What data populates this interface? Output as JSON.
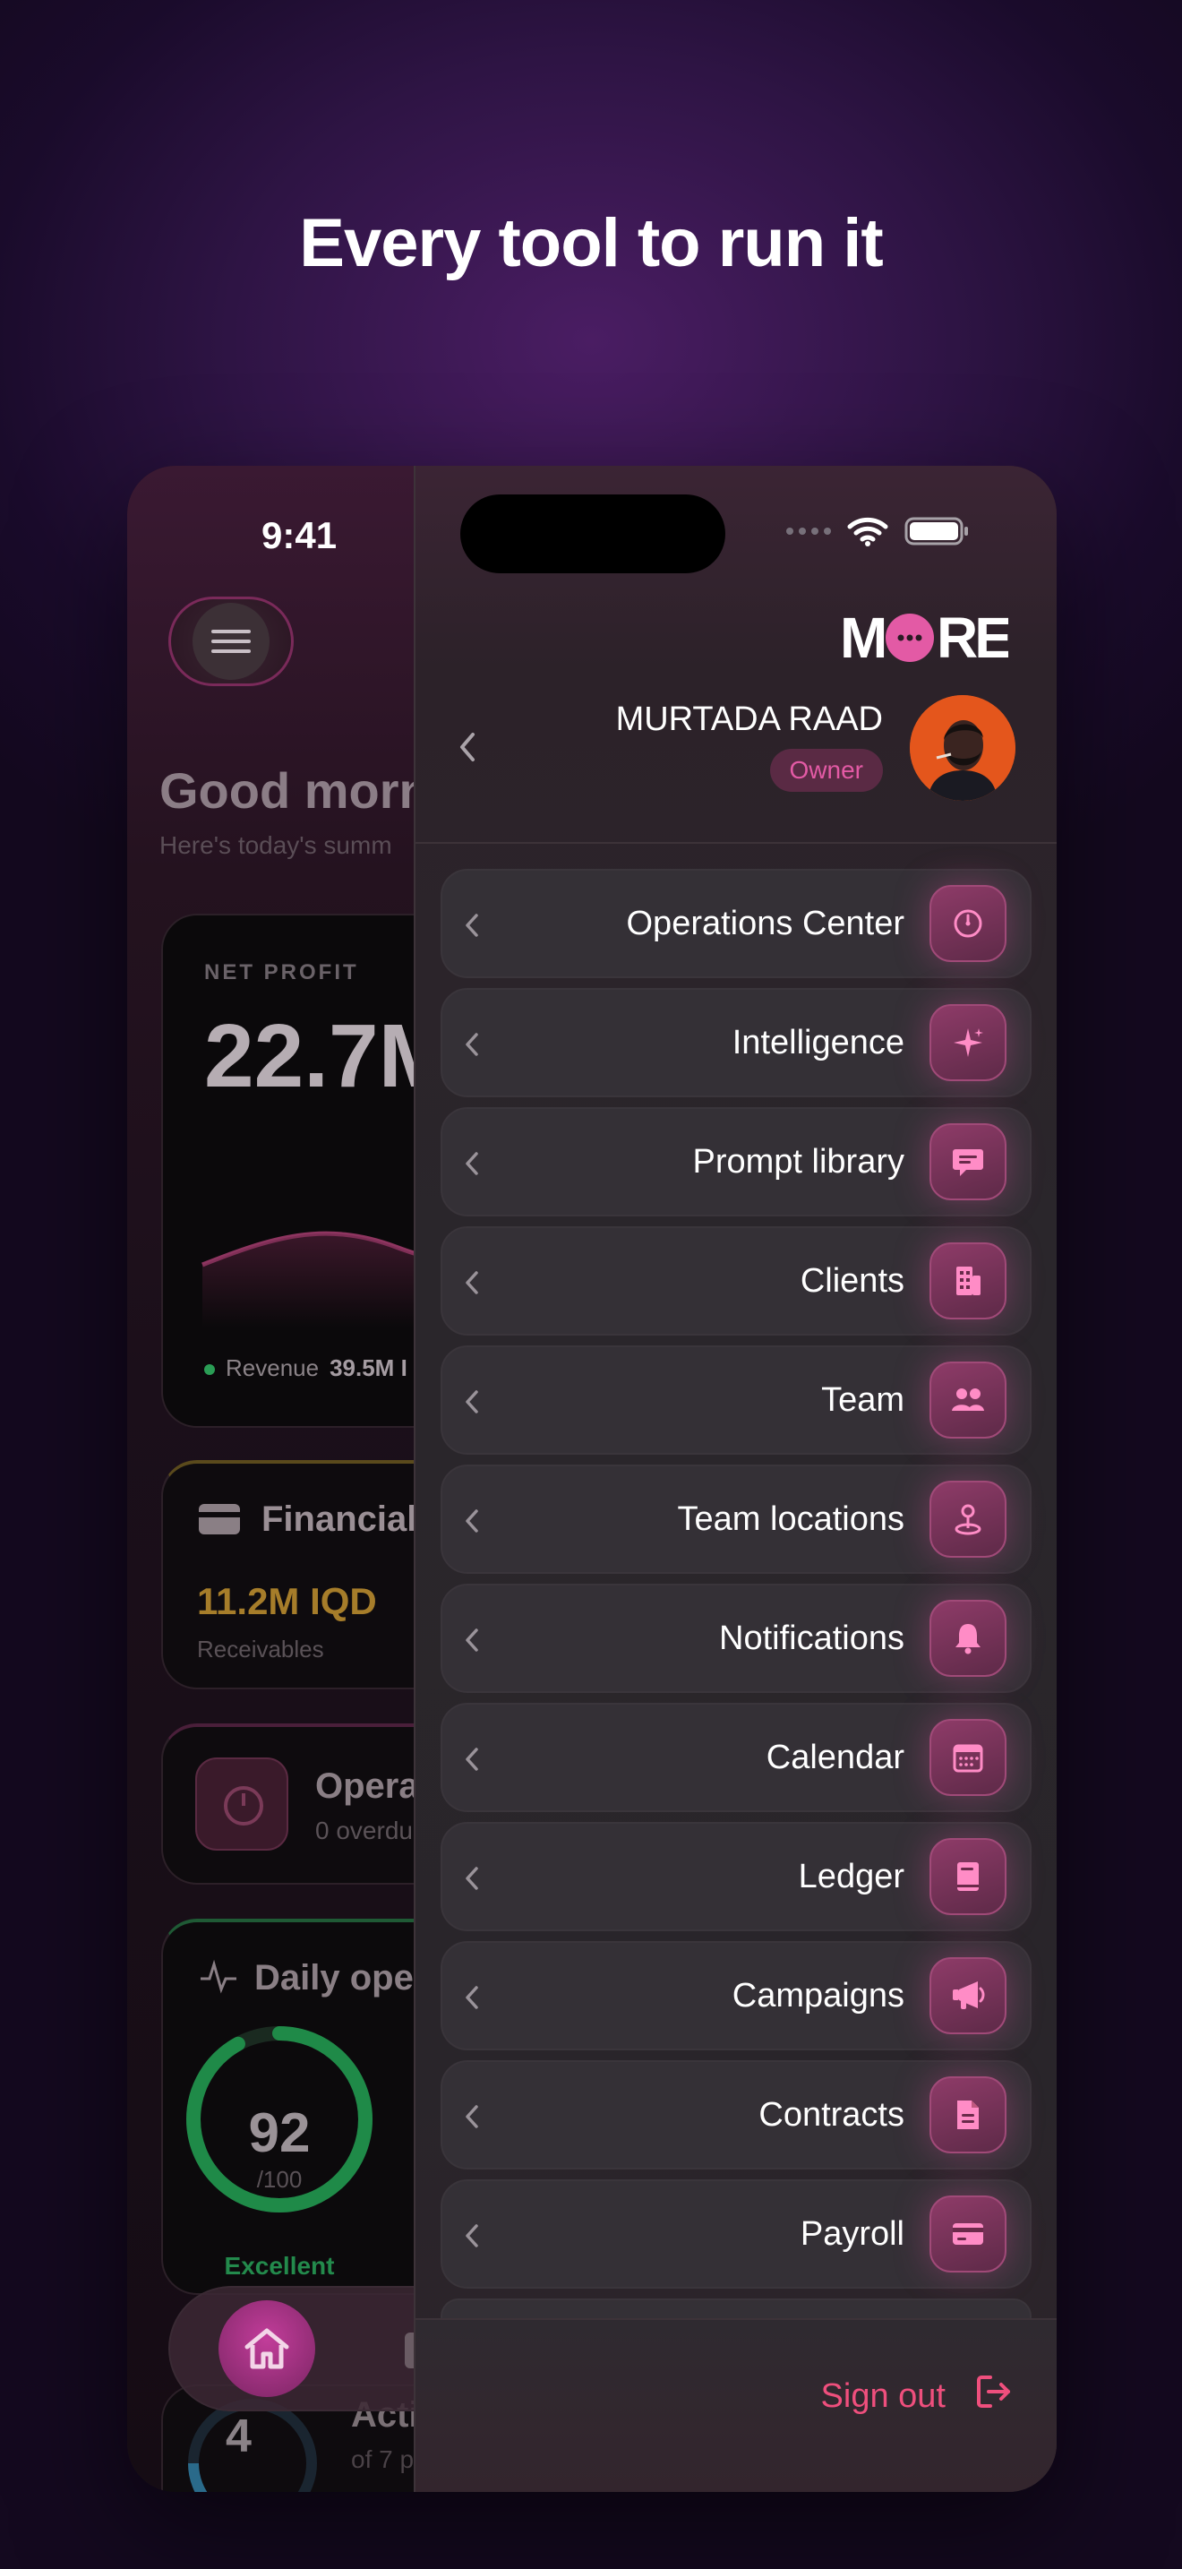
{
  "headline": "Every tool to run it",
  "status_bar": {
    "time": "9:41"
  },
  "dashboard": {
    "greeting": "Good morn",
    "greeting_sub": "Here's today's summ",
    "net_profit": {
      "label": "NET PROFIT",
      "value": "22.7M",
      "legend_label": "Revenue",
      "legend_value": "39.5M I"
    },
    "financial": {
      "title": "Financial",
      "value": "11.2M IQD",
      "sub": "Receivables"
    },
    "operations": {
      "title": "Opera",
      "sub": "0 overdu"
    },
    "daily": {
      "title": "Daily oper",
      "score": "92",
      "max": "/100",
      "rating": "Excellent",
      "score_fraction": 0.92
    },
    "activity": {
      "number": "4",
      "title": "Activ",
      "sub": "of 7 pr"
    }
  },
  "drawer": {
    "brand": "MORE",
    "profile": {
      "name": "MURTADA RAAD",
      "role": "Owner"
    },
    "items": [
      {
        "label": "Operations Center",
        "icon": "gauge-icon"
      },
      {
        "label": "Intelligence",
        "icon": "sparkle-icon"
      },
      {
        "label": "Prompt library",
        "icon": "chat-bubble-icon"
      },
      {
        "label": "Clients",
        "icon": "building-icon"
      },
      {
        "label": "Team",
        "icon": "people-icon"
      },
      {
        "label": "Team locations",
        "icon": "location-pin-icon"
      },
      {
        "label": "Notifications",
        "icon": "bell-icon"
      },
      {
        "label": "Calendar",
        "icon": "calendar-icon"
      },
      {
        "label": "Ledger",
        "icon": "book-icon"
      },
      {
        "label": "Campaigns",
        "icon": "megaphone-icon"
      },
      {
        "label": "Contracts",
        "icon": "document-icon"
      },
      {
        "label": "Payroll",
        "icon": "credit-card-icon"
      }
    ],
    "sign_out": "Sign out"
  },
  "colors": {
    "accent": "#e35aa5",
    "danger": "#ef4f7d",
    "success": "#238a4c",
    "warning": "#a67d2a"
  }
}
